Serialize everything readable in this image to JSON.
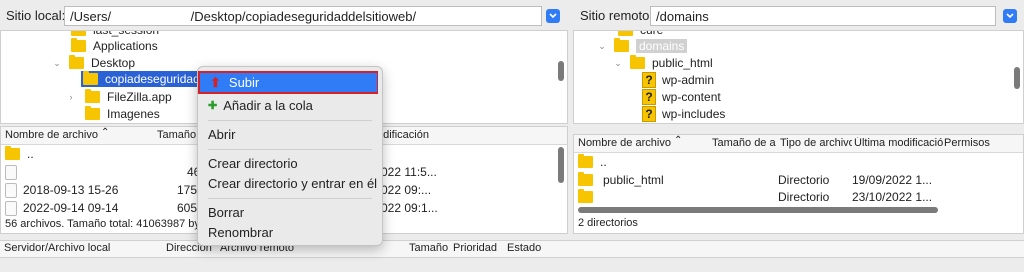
{
  "local": {
    "label": "Sitio local:",
    "path": "/Users/                      /Desktop/copiadeseguridaddelsitioweb/",
    "tree": [
      {
        "label": "last_session",
        "partial": true
      },
      {
        "label": "Applications"
      },
      {
        "label": "Desktop"
      },
      {
        "label": "copiadeseguridadd"
      },
      {
        "label": "FileZilla.app"
      },
      {
        "label": "Imagenes"
      }
    ],
    "columns": {
      "name": "Nombre de archivo",
      "size": "Tamaño",
      "mod": "odificación"
    },
    "files": [
      {
        "name": "..",
        "size": "",
        "date": ""
      },
      {
        "name": "",
        "size": "46",
        "date": "022 11:5..."
      },
      {
        "name": "2018-09-13 15-26",
        "size": "175",
        "date": "022 09:..."
      },
      {
        "name": "2022-09-14 09-14",
        "size": "605",
        "date": "022 09:1..."
      }
    ],
    "status": "56 archivos. Tamaño total: 41063987 by"
  },
  "remote": {
    "label": "Sitio remoto:",
    "path": "/domains",
    "tree": [
      {
        "label": "cure",
        "partial": true
      },
      {
        "label": "domains"
      },
      {
        "label": "public_html"
      },
      {
        "label": "wp-admin"
      },
      {
        "label": "wp-content"
      },
      {
        "label": "wp-includes"
      }
    ],
    "columns": {
      "name": "Nombre de archivo",
      "size": "Tamaño de ar",
      "type": "Tipo de archivo",
      "mod": "Última modificació",
      "perm": "Permisos"
    },
    "files": [
      {
        "name": "..",
        "type": "",
        "date": ""
      },
      {
        "name": "public_html",
        "type": "Directorio",
        "date": "19/09/2022 1..."
      },
      {
        "name": "",
        "type": "Directorio",
        "date": "23/10/2022 1..."
      }
    ],
    "status": "2 directorios"
  },
  "context_menu": {
    "upload": "Subir",
    "queue": "Añadir a la cola",
    "open": "Abrir",
    "create_dir": "Crear directorio",
    "create_dir_enter": "Crear directorio y entrar en él",
    "delete": "Borrar",
    "rename": "Renombrar"
  },
  "queue": {
    "columns": [
      "Servidor/Archivo local",
      "Direccion",
      "Archivo remoto",
      "Tamaño",
      "Prioridad",
      "Estado"
    ]
  },
  "colors": {
    "selection": "#2a62d6",
    "highlight": "#d62128",
    "accent": "#2f7cf6"
  }
}
